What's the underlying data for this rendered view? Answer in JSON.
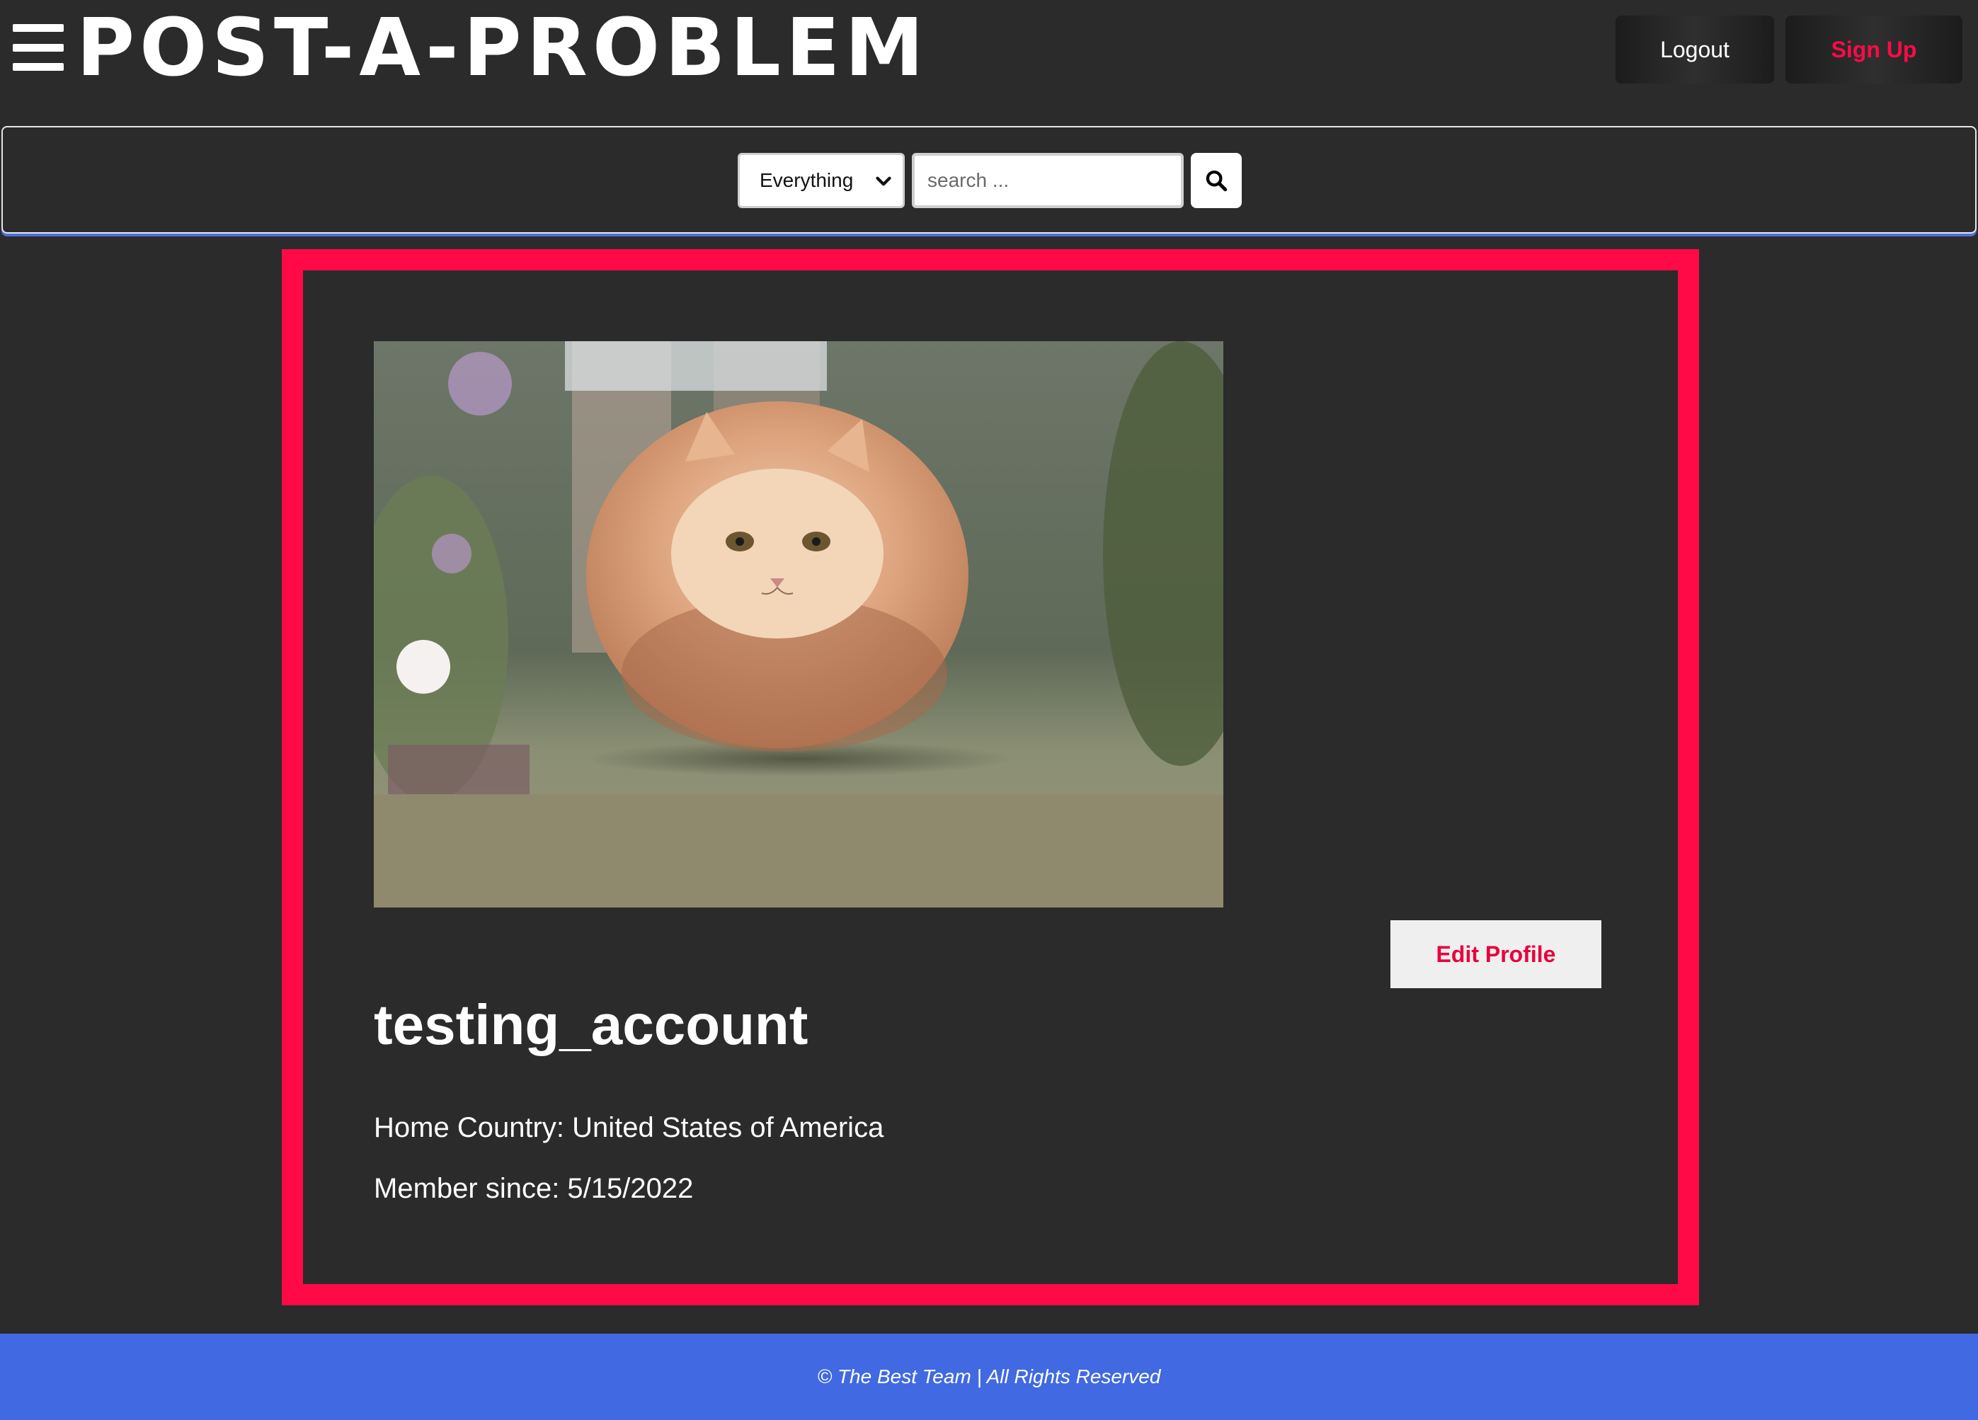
{
  "header": {
    "logo_text": "POST-A-PROBLEM",
    "logout_label": "Logout",
    "signup_label": "Sign Up",
    "accent_color": "#ff0a47"
  },
  "search": {
    "filter_selected": "Everything",
    "placeholder": "search ...",
    "button_icon": "search-icon"
  },
  "profile": {
    "username": "testing_account",
    "home_country": "Home Country: United States of America",
    "member_since": "Member since: 5/15/2022",
    "edit_label": "Edit Profile",
    "avatar_alt": "profile-photo"
  },
  "footer": {
    "text": "© The Best Team | All Rights Reserved",
    "color": "#4169e1"
  }
}
